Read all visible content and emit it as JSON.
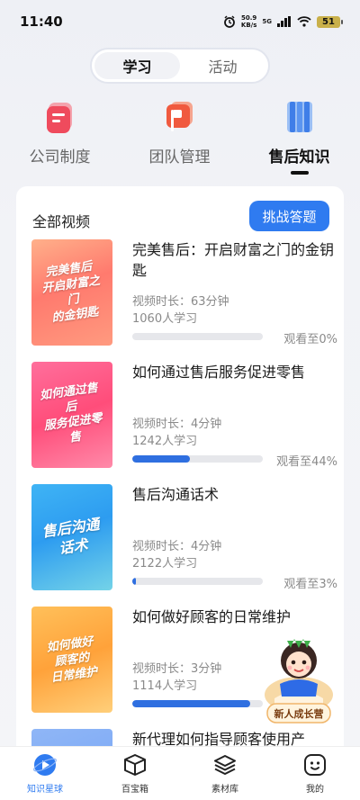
{
  "status": {
    "time": "11:40",
    "net_speed": "50.9",
    "net_unit": "KB/s",
    "signal": "5G",
    "battery": "51"
  },
  "segments": [
    {
      "label": "学习",
      "active": true
    },
    {
      "label": "活动",
      "active": false
    }
  ],
  "categories": [
    {
      "label": "公司制度",
      "icon": "document-icon"
    },
    {
      "label": "团队管理",
      "icon": "flag-icon"
    },
    {
      "label": "售后知识",
      "icon": "book-icon"
    }
  ],
  "section": {
    "title": "全部视频",
    "challenge_label": "挑战答题"
  },
  "videos": [
    {
      "title": "完美售后：开启财富之门的金钥匙",
      "thumb_text": "完美售后 开启财富之门 的金钥匙",
      "duration": "视频时长：63分钟",
      "learners": "1060人学习",
      "progress": 0,
      "watch": "观看至0%"
    },
    {
      "title": "如何通过售后服务促进零售",
      "thumb_text": "如何通过售后 服务促进零售",
      "duration": "视频时长：4分钟",
      "learners": "1242人学习",
      "progress": 44,
      "watch": "观看至44%"
    },
    {
      "title": "售后沟通话术",
      "thumb_text": "售后沟通 话术",
      "duration": "视频时长：4分钟",
      "learners": "2122人学习",
      "progress": 3,
      "watch": "观看至3%"
    },
    {
      "title": "如何做好顾客的日常维护",
      "thumb_text": "如何做好 顾客的 日常维护",
      "duration": "视频时长：3分钟",
      "learners": "1114人学习",
      "progress": 90,
      "watch": ""
    },
    {
      "title": "新代理如何指导顾客使用产",
      "thumb_text": "",
      "duration": "",
      "learners": "",
      "progress": 0,
      "watch": ""
    }
  ],
  "float_badge": {
    "label": "新人成长营"
  },
  "tabbar": [
    {
      "label": "知识星球",
      "icon": "play-planet-icon",
      "active": true
    },
    {
      "label": "百宝箱",
      "icon": "box-icon",
      "active": false
    },
    {
      "label": "素材库",
      "icon": "layers-icon",
      "active": false
    },
    {
      "label": "我的",
      "icon": "smile-face-icon",
      "active": false
    }
  ]
}
